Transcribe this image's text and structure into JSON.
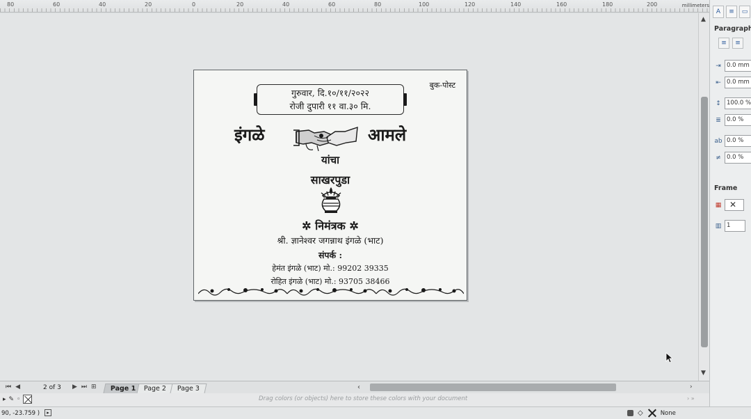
{
  "ruler": {
    "ticks": [
      "80",
      "60",
      "40",
      "20",
      "0",
      "20",
      "40",
      "60",
      "80",
      "100",
      "120",
      "140",
      "160",
      "180",
      "200"
    ],
    "unit": "millimeters"
  },
  "document": {
    "post_label": "बुक-पोस्ट",
    "date_line1": "गुरुवार, दि.१०/११/२०२२",
    "date_line2": "रोजी दुपारी ११ वा.३० मि.",
    "name_left": "इंगळे",
    "name_right": "आमले",
    "yancha": "यांचा",
    "event": "साखरपुडा",
    "invitation": "✲ निमंत्रक ✲",
    "inviter": "श्री. ज्ञानेश्वर जगन्नाथ इंगळे (भाट)",
    "contact_heading": "संपर्क :",
    "contact1": "हेमंत इंगळे (भाट) मो.: 99202 39335",
    "contact2": "रोहित इंगळे (भाट) मो.: 93705 38466"
  },
  "panel": {
    "paragraph_header": "Paragraph",
    "fields": [
      "0.0 mm",
      "0.0 mm",
      "100.0 %",
      "0.0 %",
      "0.0 %",
      "0.0 %"
    ],
    "frame_header": "Frame",
    "frame_count": "1"
  },
  "pagebar": {
    "page_count": "2 of 3",
    "tabs": [
      "Page 1",
      "Page 2",
      "Page 3"
    ],
    "active_tab": "Page 1"
  },
  "colorbar": {
    "hint": "Drag colors (or objects) here to store these colors with your document"
  },
  "status": {
    "coordinates": "90, -23.759 )",
    "fill": "None"
  },
  "colors": {
    "canvas": "#e3e5e6",
    "document": "#f5f6f4",
    "accent": "#2b5b9c"
  }
}
